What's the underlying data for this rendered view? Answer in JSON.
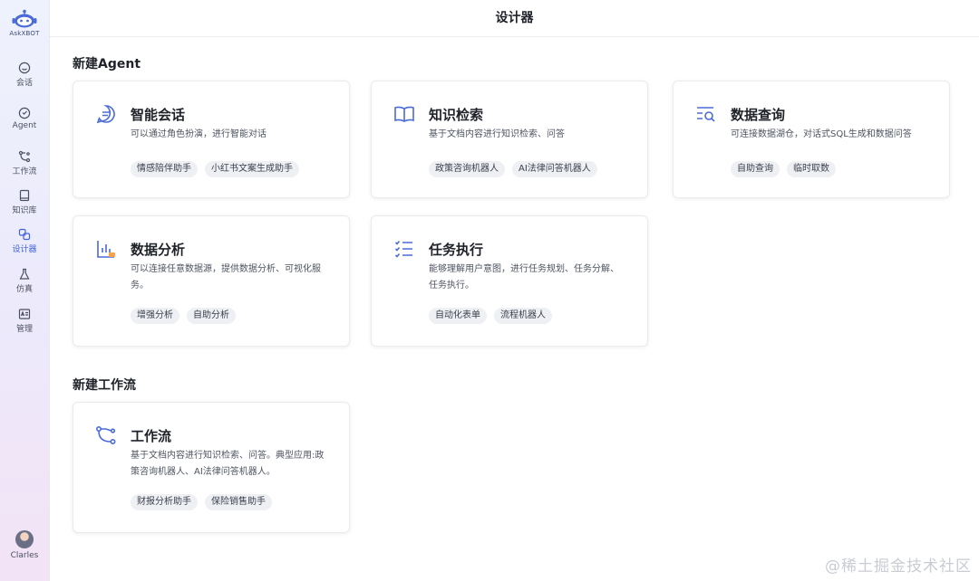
{
  "app": {
    "logo_text": "AskXBOT",
    "header_title": "设计器"
  },
  "sidebar": {
    "items": [
      {
        "label": "会话",
        "icon": "chat-icon"
      },
      {
        "label": "Agent",
        "icon": "agent-icon"
      },
      {
        "label": "工作流",
        "icon": "workflow-icon"
      },
      {
        "label": "知识库",
        "icon": "knowledge-icon"
      },
      {
        "label": "设计器",
        "icon": "designer-icon",
        "active": true
      },
      {
        "label": "仿真",
        "icon": "flask-icon"
      },
      {
        "label": "管理",
        "icon": "admin-icon"
      }
    ],
    "user_name": "Clarles"
  },
  "sections": {
    "agent_title": "新建Agent",
    "workflow_title": "新建工作流"
  },
  "cards": {
    "chat": {
      "title": "智能会话",
      "desc": "可以通过角色扮演，进行智能对话",
      "tags": [
        "情感陪伴助手",
        "小红书文案生成助手"
      ]
    },
    "knowledge": {
      "title": "知识检索",
      "desc": "基于文档内容进行知识检索、问答",
      "tags": [
        "政策咨询机器人",
        "AI法律问答机器人"
      ]
    },
    "query": {
      "title": "数据查询",
      "desc": "可连接数据湖仓，对话式SQL生成和数据问答",
      "tags": [
        "自助查询",
        "临时取数"
      ]
    },
    "analysis": {
      "title": "数据分析",
      "desc": "可以连接任意数据源，提供数据分析、可视化服务。",
      "tags": [
        "增强分析",
        "自助分析"
      ]
    },
    "task": {
      "title": "任务执行",
      "desc": "能够理解用户意图，进行任务规划、任务分解、任务执行。",
      "tags": [
        "自动化表单",
        "流程机器人"
      ]
    },
    "workflow": {
      "title": "工作流",
      "desc": "基于文档内容进行知识检索、问答。典型应用:政策咨询机器人、AI法律问答机器人。",
      "tags": [
        "财报分析助手",
        "保险销售助手"
      ]
    }
  },
  "colors": {
    "accent": "#3e63dd",
    "icon": "#4a6bd8",
    "tag_bg": "#eef0f4"
  },
  "watermark": "@稀土掘金技术社区"
}
